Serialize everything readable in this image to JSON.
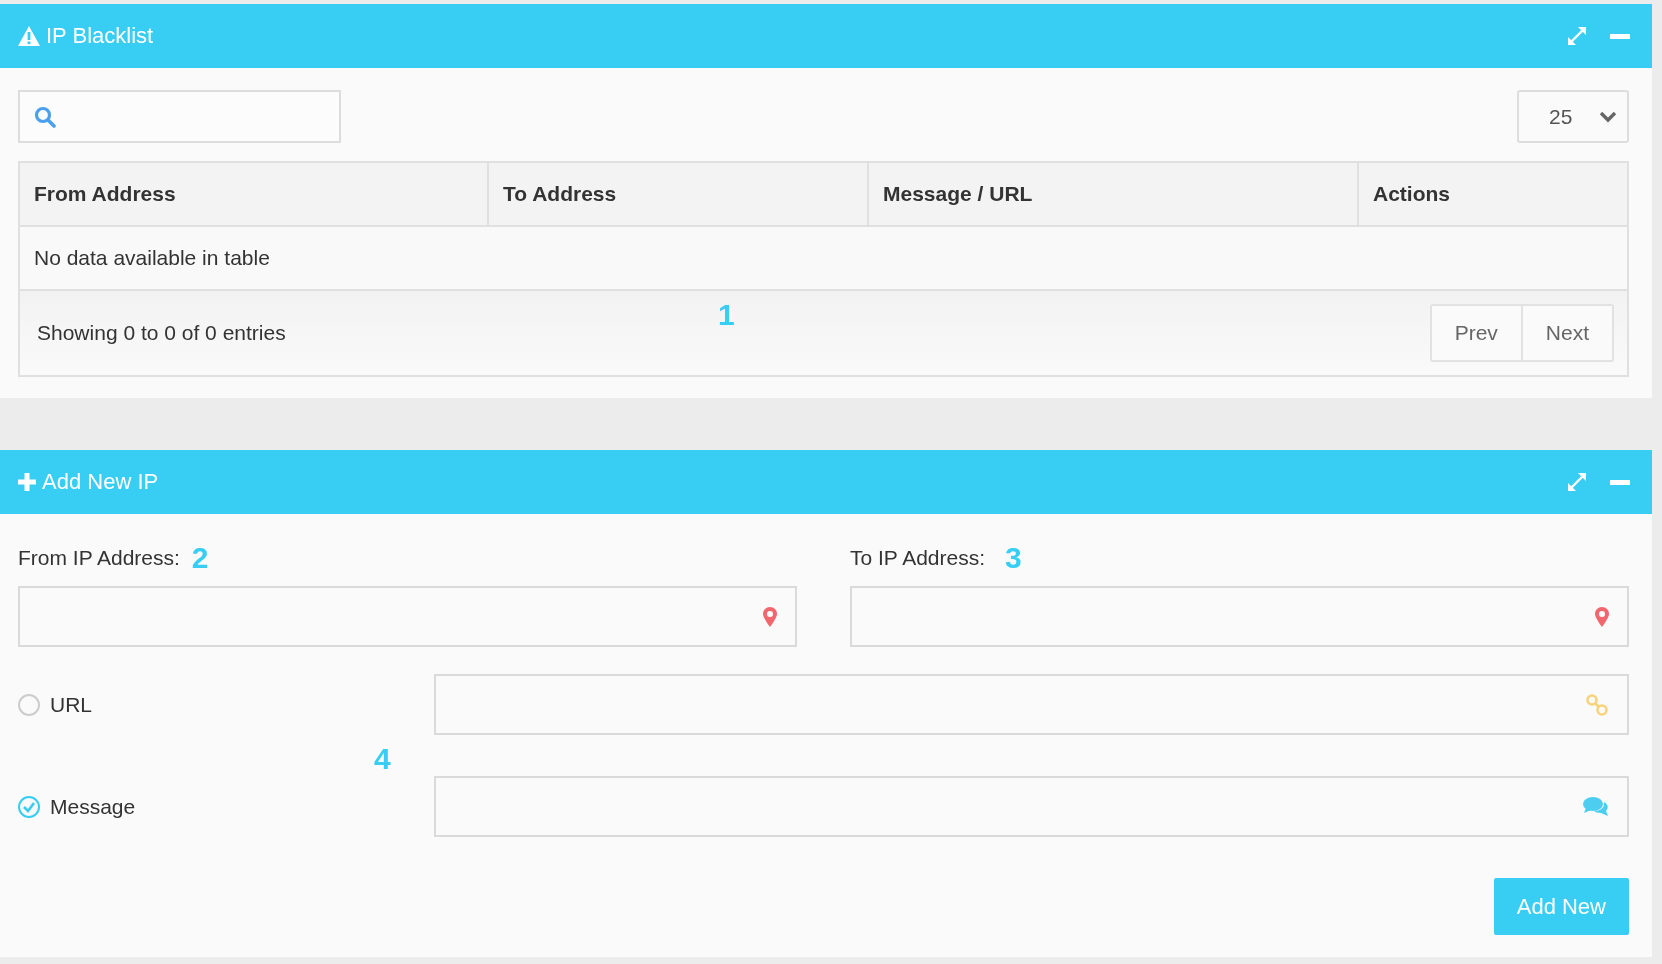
{
  "blacklist_panel": {
    "title": "IP Blacklist",
    "page_size": "25",
    "table": {
      "columns": [
        "From Address",
        "To Address",
        "Message / URL",
        "Actions"
      ],
      "empty_message": "No data available in table"
    },
    "info": "Showing 0 to 0 of 0 entries",
    "pagination": [
      "Prev",
      "Next"
    ],
    "callout": "1"
  },
  "add_panel": {
    "title": "Add New IP",
    "ip_fields": [
      {
        "label": "From IP Address:",
        "callout": "2"
      },
      {
        "label": "To IP Address:",
        "callout": "3"
      }
    ],
    "content_options": [
      {
        "kind": "url",
        "label": "URL",
        "selected": false
      },
      {
        "kind": "message",
        "label": "Message",
        "selected": true
      }
    ],
    "callout": "4",
    "button": "Add New"
  }
}
